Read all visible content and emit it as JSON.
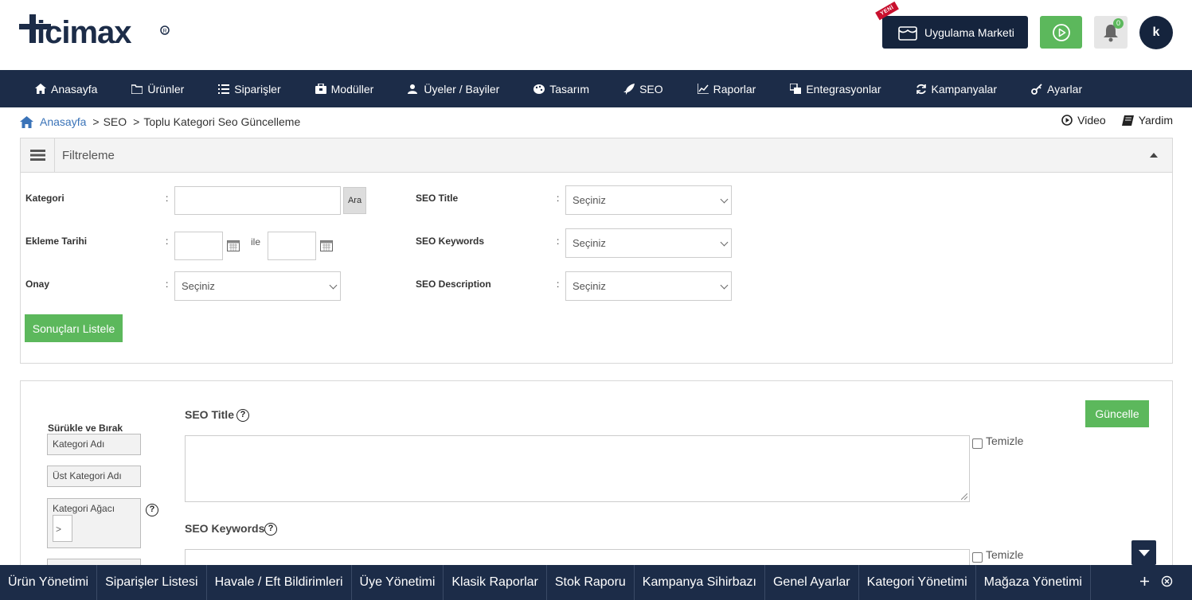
{
  "header": {
    "logo_text": "ticimax",
    "market_label": "Uygulama Marketi",
    "new_badge": "YENİ",
    "notification_count": "0",
    "avatar_initial": "k"
  },
  "nav": {
    "items": [
      {
        "label": "Anasayfa",
        "icon": "home-icon"
      },
      {
        "label": "Ürünler",
        "icon": "folder-icon"
      },
      {
        "label": "Siparişler",
        "icon": "list-icon"
      },
      {
        "label": "Modüller",
        "icon": "module-icon"
      },
      {
        "label": "Üyeler / Bayiler",
        "icon": "users-icon"
      },
      {
        "label": "Tasarım",
        "icon": "palette-icon"
      },
      {
        "label": "SEO",
        "icon": "rocket-icon"
      },
      {
        "label": "Raporlar",
        "icon": "chart-icon"
      },
      {
        "label": "Entegrasyonlar",
        "icon": "integration-icon"
      },
      {
        "label": "Kampanyalar",
        "icon": "refresh-icon"
      },
      {
        "label": "Ayarlar",
        "icon": "key-icon"
      }
    ]
  },
  "breadcrumb": {
    "home": "Anasayfa",
    "items": [
      "SEO",
      "Toplu Kategori Seo Güncelleme"
    ],
    "separator": ">"
  },
  "help": {
    "video": "Video",
    "help": "Yardim"
  },
  "filter": {
    "title": "Filtreleme",
    "kategori_label": "Kategori",
    "kategori_value": "",
    "ara_label": "Ara",
    "ekleme_label": "Ekleme Tarihi",
    "ile_label": "ile",
    "onay_label": "Onay",
    "onay_value": "Seçiniz",
    "seo_title_label": "SEO Title",
    "seo_title_value": "Seçiniz",
    "seo_keywords_label": "SEO Keywords",
    "seo_keywords_value": "Seçiniz",
    "seo_description_label": "SEO Description",
    "seo_description_value": "Seçiniz",
    "colon": ":",
    "list_button": "Sonuçları Listele"
  },
  "edit": {
    "drag_title": "Sürükle ve Bırak",
    "drag_items": [
      "Kategori Adı",
      "Üst Kategori Adı",
      "Kategori Ağacı"
    ],
    "tree_symbol": ">",
    "seo_title_label": "SEO Title",
    "seo_keywords_label": "SEO Keywords",
    "clear_label": "Temizle",
    "update_button": "Güncelle",
    "help_symbol": "?"
  },
  "taskbar": {
    "items": [
      "Ürün Yönetimi",
      "Siparişler Listesi",
      "Havale / Eft Bildirimleri",
      "Üye Yönetimi",
      "Klasik Raporlar",
      "Stok Raporu",
      "Kampanya Sihirbazı",
      "Genel Ayarlar",
      "Kategori Yönetimi",
      "Mağaza Yönetimi"
    ]
  },
  "colors": {
    "navy": "#1c2c48",
    "header_button": "#15243d",
    "green": "#5cb85c",
    "link_blue": "#3a73b8"
  }
}
